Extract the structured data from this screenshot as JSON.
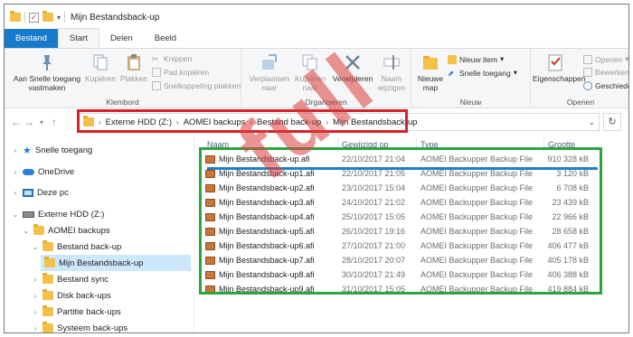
{
  "window": {
    "title": "Mijn Bestandsback-up"
  },
  "ribbon_tabs": [
    "Bestand",
    "Start",
    "Delen",
    "Beeld"
  ],
  "ribbon": {
    "pin_label": "Aan Snelle toegang vastmaken",
    "copy_label": "Kopiëren",
    "paste_label": "Plakken",
    "cut_label": "Knippen",
    "copy_path_label": "Pad kopiëren",
    "paste_shortcut_label": "Snelkoppeling plakken",
    "clipboard_group": "Klembord",
    "move_to_label": "Verplaatsen naar",
    "copy_to_label": "Kopiëren naar",
    "delete_label": "Verwijderen",
    "rename_label": "Naam wijzigen",
    "organize_group": "Organiseren",
    "new_folder_label": "Nieuwe map",
    "new_item_label": "Nieuw item",
    "easy_access_label": "Snelle toegang",
    "new_group": "Nieuw",
    "properties_label": "Eigenschappen",
    "open_label": "Openen",
    "edit_label": "Bewerken",
    "history_label": "Geschiedenis",
    "open_group": "Openen"
  },
  "breadcrumb": [
    "Externe HDD (Z:)",
    "AOMEI backups",
    "Bestand back-up",
    "Mijn Bestandsback-up"
  ],
  "nav_tree": [
    {
      "label": "Snelle toegang"
    },
    {
      "label": "OneDrive"
    },
    {
      "label": "Deze pc"
    },
    {
      "label": "Externe HDD (Z:)"
    },
    {
      "label": "AOMEI backups"
    },
    {
      "label": "Bestand back-up"
    },
    {
      "label": "Mijn Bestandsback-up"
    },
    {
      "label": "Bestand sync"
    },
    {
      "label": "Disk back-ups"
    },
    {
      "label": "Partitie back-ups"
    },
    {
      "label": "Systeem back-ups"
    }
  ],
  "columns": {
    "name": "Naam",
    "modified": "Gewijzigd op",
    "type": "Type",
    "size": "Grootte"
  },
  "files": [
    {
      "name": "Mijn Bestandsback-up.afi",
      "modified": "22/10/2017 21:04",
      "type": "AOMEI Backupper Backup File",
      "size": "910 328 kB"
    },
    {
      "name": "Mijn Bestandsback-up1.afi",
      "modified": "22/10/2017 21:05",
      "type": "AOMEI Backupper Backup File",
      "size": "3 120 kB"
    },
    {
      "name": "Mijn Bestandsback-up2.afi",
      "modified": "23/10/2017 15:04",
      "type": "AOMEI Backupper Backup File",
      "size": "6 708 kB"
    },
    {
      "name": "Mijn Bestandsback-up3.afi",
      "modified": "24/10/2017 21:02",
      "type": "AOMEI Backupper Backup File",
      "size": "23 439 kB"
    },
    {
      "name": "Mijn Bestandsback-up4.afi",
      "modified": "25/10/2017 15:05",
      "type": "AOMEI Backupper Backup File",
      "size": "22 966 kB"
    },
    {
      "name": "Mijn Bestandsback-up5.afi",
      "modified": "26/10/2017 19:16",
      "type": "AOMEI Backupper Backup File",
      "size": "28 658 kB"
    },
    {
      "name": "Mijn Bestandsback-up6.afi",
      "modified": "27/10/2017 21:00",
      "type": "AOMEI Backupper Backup File",
      "size": "406 477 kB"
    },
    {
      "name": "Mijn Bestandsback-up7.afi",
      "modified": "28/10/2017 20:07",
      "type": "AOMEI Backupper Backup File",
      "size": "405 178 kB"
    },
    {
      "name": "Mijn Bestandsback-up8.afi",
      "modified": "30/10/2017 21:49",
      "type": "AOMEI Backupper Backup File",
      "size": "406 388 kB"
    },
    {
      "name": "Mijn Bestandsback-up9.afi",
      "modified": "31/10/2017 15:05",
      "type": "AOMEI Backupper Backup File",
      "size": "419 884 kB"
    }
  ],
  "watermark": "full",
  "colors": {
    "highlight_red": "#d6222a",
    "highlight_green": "#2aa641",
    "highlight_blue": "#1f7fc8",
    "file_tab": "#1979ca"
  }
}
